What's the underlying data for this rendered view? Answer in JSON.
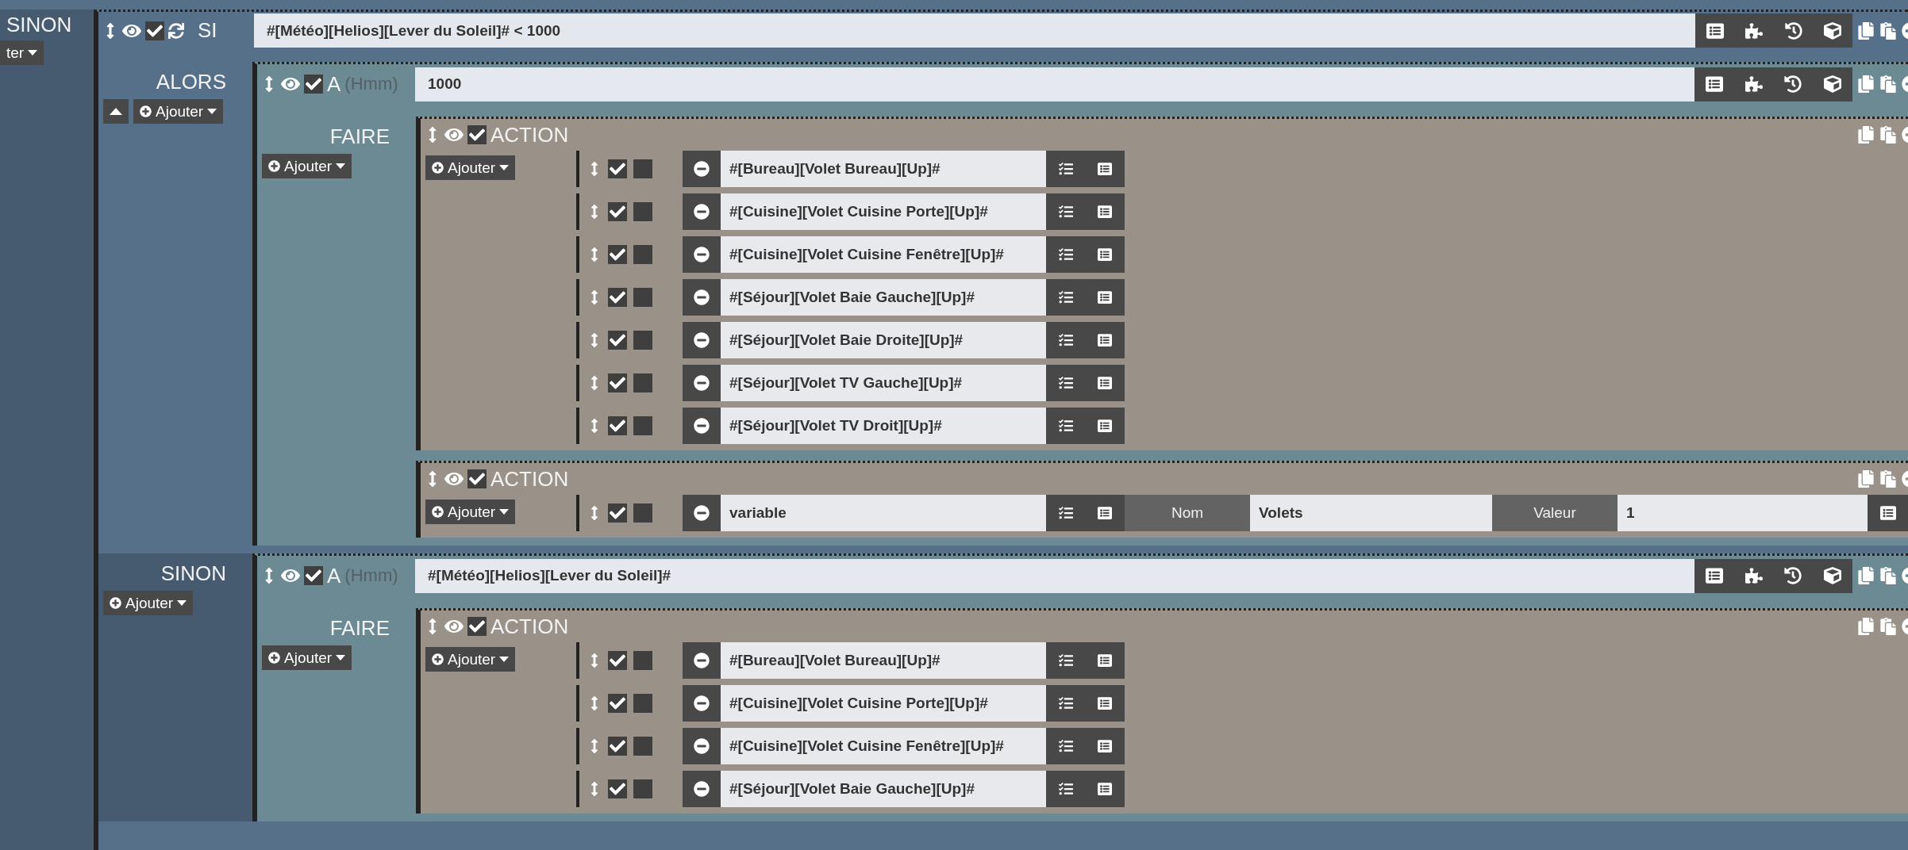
{
  "outer": {
    "label": "SINON",
    "add_button": "ter"
  },
  "condition": {
    "label": "SI",
    "enabled": true,
    "expression": "#[Météo][Helios][Lever du Soleil]# < 1000"
  },
  "branches": [
    {
      "kind": "then",
      "label": "ALORS",
      "add_button": "Ajouter",
      "blocks": [
        {
          "label": "A",
          "hint": "(Hmm)",
          "enabled": true,
          "value": "1000",
          "do_label": "FAIRE",
          "add_button": "Ajouter",
          "actions": [
            {
              "label": "ACTION",
              "enabled": true,
              "add_button": "Ajouter",
              "rows": [
                {
                  "kind": "command",
                  "enabled": true,
                  "flag_checked": false,
                  "value": "#[Bureau][Volet Bureau][Up]#"
                },
                {
                  "kind": "command",
                  "enabled": true,
                  "flag_checked": false,
                  "value": "#[Cuisine][Volet Cuisine Porte][Up]#"
                },
                {
                  "kind": "command",
                  "enabled": true,
                  "flag_checked": false,
                  "value": "#[Cuisine][Volet Cuisine Fenêtre][Up]#"
                },
                {
                  "kind": "command",
                  "enabled": true,
                  "flag_checked": false,
                  "value": "#[Séjour][Volet Baie Gauche][Up]#"
                },
                {
                  "kind": "command",
                  "enabled": true,
                  "flag_checked": false,
                  "value": "#[Séjour][Volet Baie Droite][Up]#"
                },
                {
                  "kind": "command",
                  "enabled": true,
                  "flag_checked": false,
                  "value": "#[Séjour][Volet TV Gauche][Up]#"
                },
                {
                  "kind": "command",
                  "enabled": true,
                  "flag_checked": false,
                  "value": "#[Séjour][Volet TV Droit][Up]#"
                }
              ]
            },
            {
              "label": "ACTION",
              "enabled": true,
              "add_button": "Ajouter",
              "rows": [
                {
                  "kind": "variable",
                  "enabled": true,
                  "flag_checked": false,
                  "value": "variable",
                  "fields": [
                    {
                      "label": "Nom",
                      "value": "Volets"
                    },
                    {
                      "label": "Valeur",
                      "value": "1"
                    }
                  ]
                }
              ]
            }
          ]
        }
      ]
    },
    {
      "kind": "else",
      "label": "SINON",
      "add_button": "Ajouter",
      "blocks": [
        {
          "label": "A",
          "hint": "(Hmm)",
          "enabled": true,
          "value": "#[Météo][Helios][Lever du Soleil]#",
          "do_label": "FAIRE",
          "add_button": "Ajouter",
          "actions": [
            {
              "label": "ACTION",
              "enabled": true,
              "add_button": "Ajouter",
              "rows": [
                {
                  "kind": "command",
                  "enabled": true,
                  "flag_checked": false,
                  "value": "#[Bureau][Volet Bureau][Up]#"
                },
                {
                  "kind": "command",
                  "enabled": true,
                  "flag_checked": false,
                  "value": "#[Cuisine][Volet Cuisine Porte][Up]#"
                },
                {
                  "kind": "command",
                  "enabled": true,
                  "flag_checked": false,
                  "value": "#[Cuisine][Volet Cuisine Fenêtre][Up]#"
                },
                {
                  "kind": "command",
                  "enabled": true,
                  "flag_checked": false,
                  "value": "#[Séjour][Volet Baie Gauche][Up]#"
                }
              ]
            }
          ]
        }
      ]
    }
  ]
}
